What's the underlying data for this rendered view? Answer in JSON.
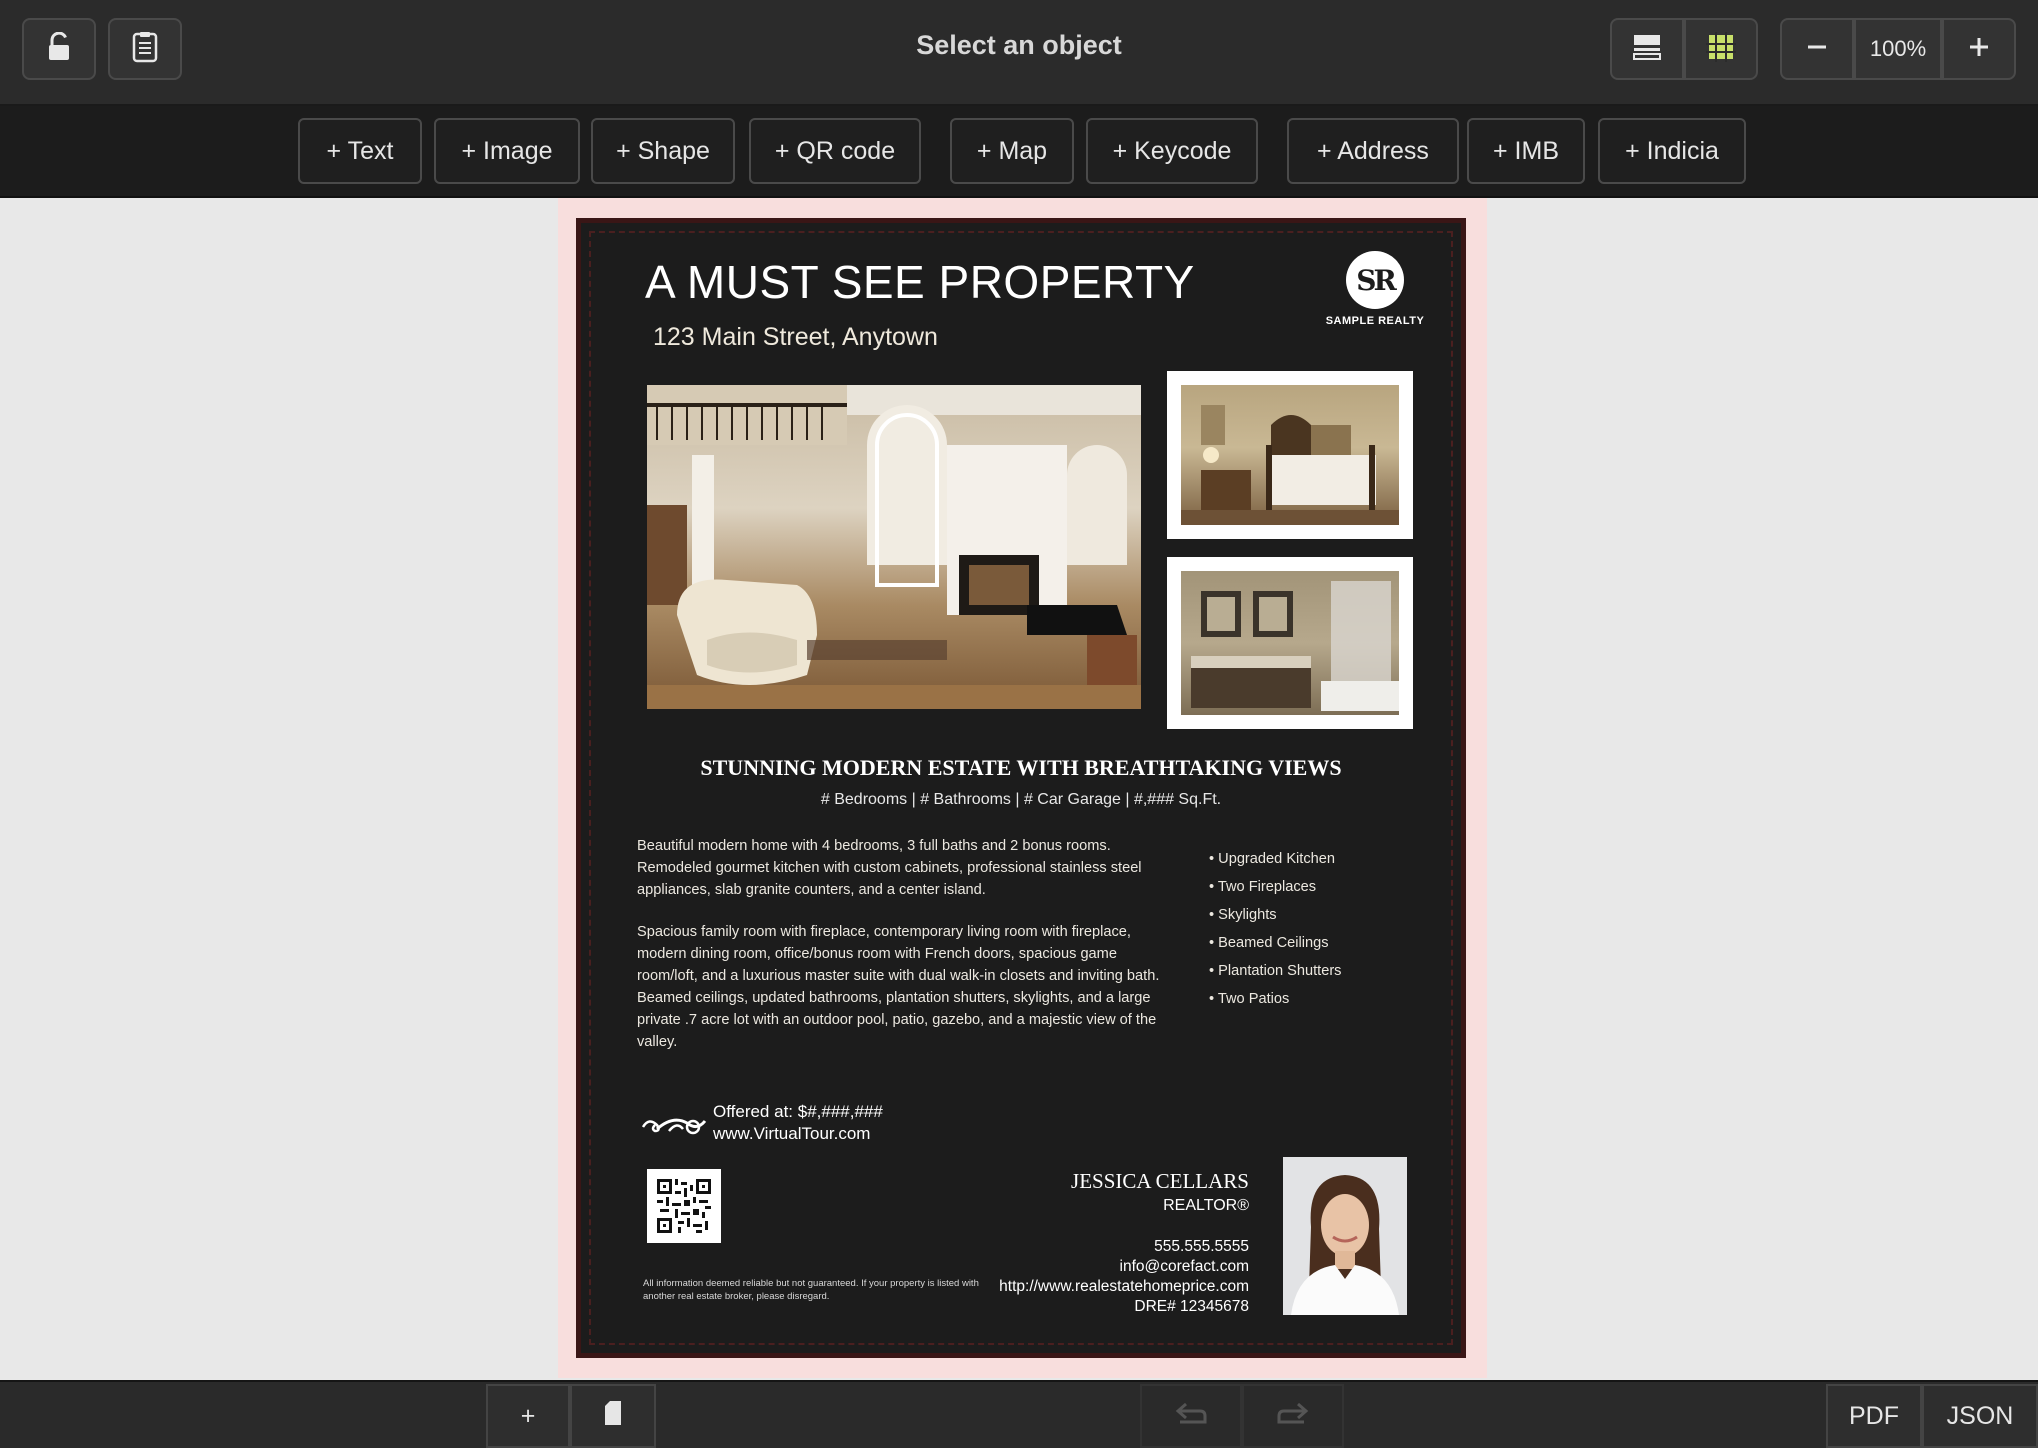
{
  "toolbar": {
    "title": "Select an object",
    "zoom": "100%",
    "lock_icon": "unlock-icon",
    "notes_icon": "notes-icon"
  },
  "insert": {
    "buttons": [
      "+ Text",
      "+ Image",
      "+ Shape",
      "+ QR code",
      "+ Map",
      "+ Keycode",
      "+ Address",
      "+ IMB",
      "+ Indicia"
    ]
  },
  "flyer": {
    "headline": "A MUST SEE PROPERTY",
    "address": "123 Main Street, Anytown",
    "logo_initials": "SR",
    "logo_text": "SAMPLE REALTY",
    "subhead": "STUNNING MODERN ESTATE WITH BREATHTAKING VIEWS",
    "stats": "# Bedrooms | # Bathrooms | # Car Garage | #,### Sq.Ft.",
    "para1": "Beautiful modern home with 4 bedrooms, 3 full baths and 2 bonus rooms. Remodeled gourmet kitchen with custom cabinets, professional stainless steel appliances, slab granite counters, and a center island.",
    "para2": "Spacious family room with fireplace, contemporary living room with fireplace, modern dining room, office/bonus room with French doors, spacious game room/loft, and a luxurious master suite with dual walk-in closets and inviting bath. Beamed ceilings, updated bathrooms, plantation shutters, skylights, and a large private .7 acre lot with an outdoor pool, patio, gazebo, and a majestic view of the valley.",
    "features": [
      "• Upgraded Kitchen",
      "• Two Fireplaces",
      "• Skylights",
      "• Beamed Ceilings",
      "• Plantation Shutters",
      "• Two Patios"
    ],
    "offer_price": "Offered at: $#,###,###",
    "offer_url": "www.VirtualTour.com",
    "agent_name": "JESSICA CELLARS",
    "agent_title": "REALTOR®",
    "agent_phone": "555.555.5555",
    "agent_email": "info@corefact.com",
    "agent_site": "http://www.realestatehomeprice.com",
    "agent_dre": "DRE# 12345678",
    "disclaimer": "All information deemed reliable but not guaranteed. If your property is listed with another real estate broker, please disregard."
  },
  "bottom": {
    "pdf": "PDF",
    "json": "JSON",
    "add": "+"
  },
  "colors": {
    "accent_green": "#c8e06a",
    "flyer_bg": "#1c1c1c",
    "bleed": "#f8dedd"
  }
}
